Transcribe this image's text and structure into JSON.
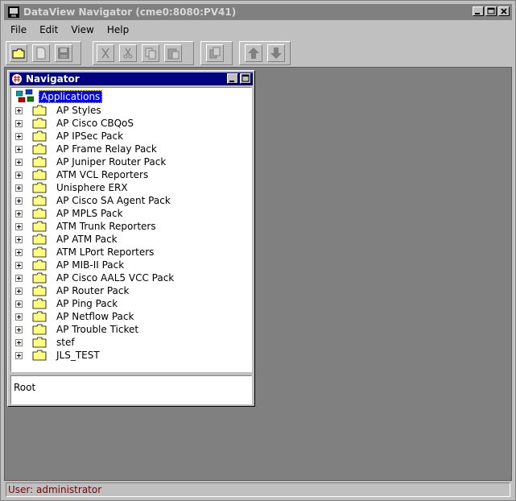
{
  "window": {
    "title": "DataView Navigator (cme0:8080:PV41)"
  },
  "menu": [
    {
      "label": "File"
    },
    {
      "label": "Edit"
    },
    {
      "label": "View"
    },
    {
      "label": "Help"
    }
  ],
  "toolbar": {
    "buttons": [
      {
        "icon": "open-folder-icon"
      },
      {
        "icon": "new-document-icon"
      },
      {
        "icon": "save-disk-icon"
      },
      {
        "icon": "delete-x-icon"
      },
      {
        "icon": "cut-scissors-icon"
      },
      {
        "icon": "copy-icon"
      },
      {
        "icon": "paste-icon"
      },
      {
        "icon": "properties-icon"
      },
      {
        "icon": "arrow-up-icon"
      },
      {
        "icon": "arrow-down-icon"
      }
    ]
  },
  "navigator": {
    "title": "Navigator",
    "root_label": "Applications",
    "items": [
      {
        "label": "AP Styles"
      },
      {
        "label": "AP Cisco CBQoS"
      },
      {
        "label": "AP IPSec Pack"
      },
      {
        "label": "AP Frame Relay Pack"
      },
      {
        "label": "AP Juniper Router Pack"
      },
      {
        "label": "ATM VCL Reporters"
      },
      {
        "label": "Unisphere ERX"
      },
      {
        "label": "AP Cisco SA Agent Pack"
      },
      {
        "label": "AP MPLS Pack"
      },
      {
        "label": "ATM Trunk Reporters"
      },
      {
        "label": "AP ATM Pack"
      },
      {
        "label": "ATM LPort Reporters"
      },
      {
        "label": "AP MIB-II Pack"
      },
      {
        "label": "AP Cisco AAL5 VCC Pack"
      },
      {
        "label": "AP Router Pack"
      },
      {
        "label": "AP Ping Pack"
      },
      {
        "label": "AP Netflow Pack"
      },
      {
        "label": "AP Trouble Ticket"
      },
      {
        "label": "stef"
      },
      {
        "label": "JLS_TEST"
      }
    ],
    "selection_path": "Root"
  },
  "status": {
    "text": "User: administrator"
  },
  "colors": {
    "selection": "#0000ff",
    "nav_title": "#000080",
    "status_text": "#800000",
    "desktop": "#808080"
  }
}
